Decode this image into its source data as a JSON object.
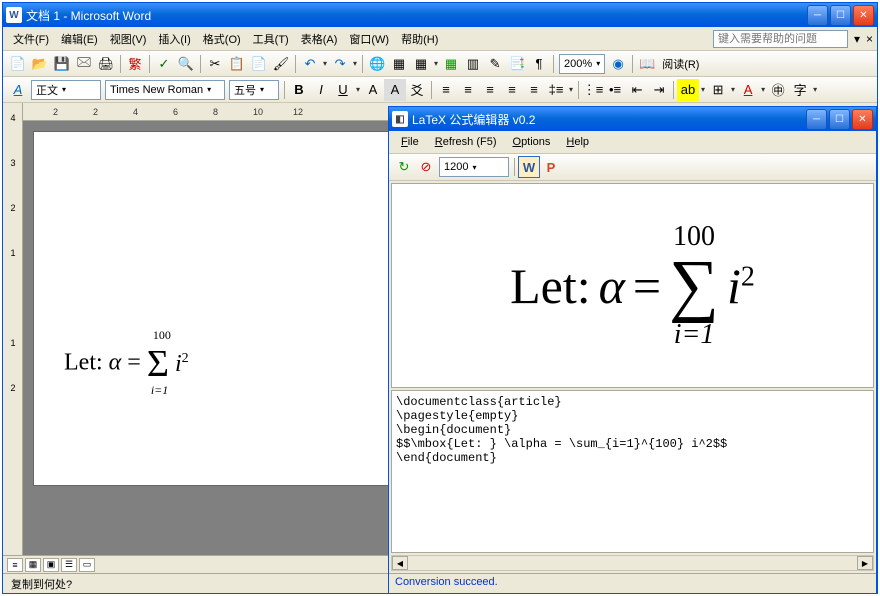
{
  "word": {
    "title": "文档 1 - Microsoft Word",
    "menu": {
      "file": "文件(F)",
      "edit": "编辑(E)",
      "view": "视图(V)",
      "insert": "插入(I)",
      "format": "格式(O)",
      "tools": "工具(T)",
      "table": "表格(A)",
      "window": "窗口(W)",
      "help": "帮助(H)"
    },
    "help_placeholder": "键入需要帮助的问题",
    "zoom": "200%",
    "read_label": "阅读(R)",
    "style": "正文",
    "font": "Times New Roman",
    "size": "五号",
    "ruler_h": [
      "2",
      "",
      "2",
      "4",
      "6",
      "8",
      "10",
      "12"
    ],
    "ruler_v": [
      "4",
      "",
      "3",
      "",
      "2",
      "",
      "1",
      "",
      "",
      "",
      "1",
      "",
      "2"
    ],
    "formula": {
      "prefix": "Let: ",
      "alpha": "α",
      "eq": " = ",
      "upper": "100",
      "lower": "i=1",
      "term": "i",
      "exp": "2"
    },
    "status": "复制到何处?"
  },
  "latex": {
    "title": "LaTeX 公式编辑器 v0.2",
    "menu": {
      "file": "File",
      "refresh": "Refresh (F5)",
      "options": "Options",
      "help": "Help"
    },
    "zoom": "1200",
    "preview": {
      "prefix": "Let: ",
      "alpha": "α",
      "eq": " = ",
      "upper": "100",
      "lower": "i=1",
      "term": "i",
      "exp": "2"
    },
    "code": "\\documentclass{article}\n\\pagestyle{empty}\n\\begin{document}\n$$\\mbox{Let: } \\alpha = \\sum_{i=1}^{100} i^2$$\n\\end{document}",
    "status": "Conversion succeed."
  }
}
